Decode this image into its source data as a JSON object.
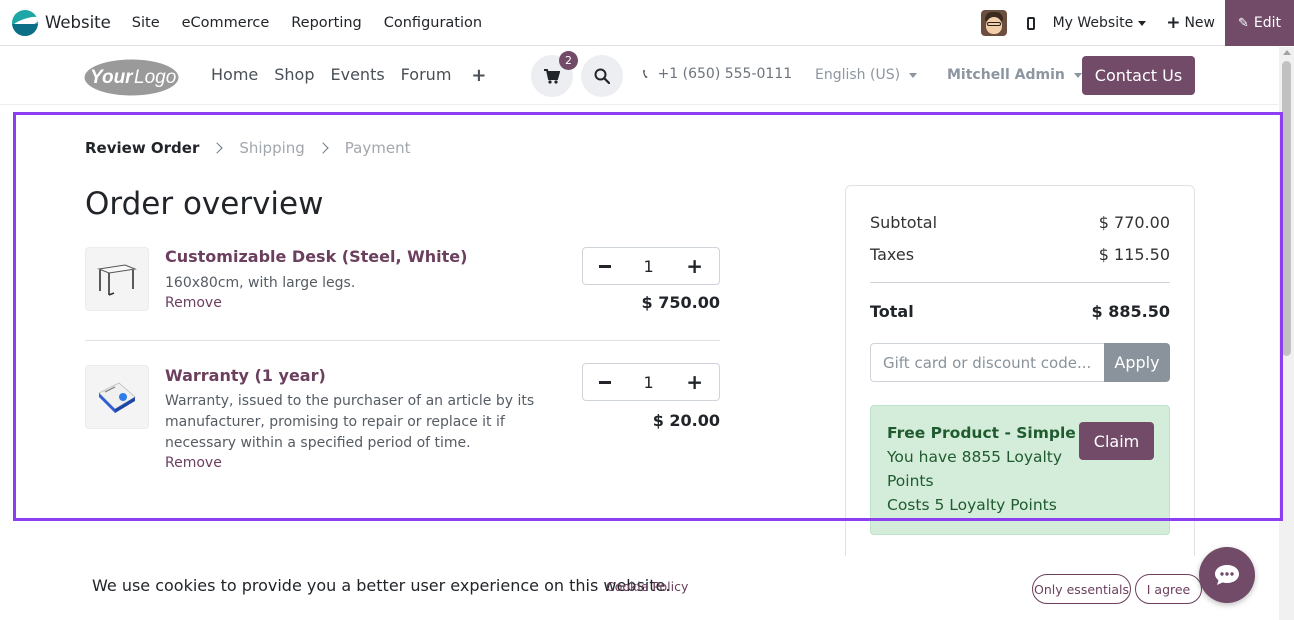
{
  "admin_bar": {
    "app_name": "Website",
    "menu": [
      "Site",
      "eCommerce",
      "Reporting",
      "Configuration"
    ],
    "website_selector": "My Website",
    "new_label": "New",
    "edit_label": "Edit"
  },
  "header": {
    "logo_text": "YourLogo",
    "nav": [
      "Home",
      "Shop",
      "Events",
      "Forum"
    ],
    "cart_count": "2",
    "phone": "+1 (650) 555-0111",
    "language": "English (US)",
    "user": "Mitchell Admin",
    "contact_label": "Contact Us"
  },
  "checkout": {
    "steps": [
      "Review Order",
      "Shipping",
      "Payment"
    ],
    "active_step": "Review Order",
    "title": "Order overview",
    "items": [
      {
        "name": "Customizable Desk (Steel, White)",
        "description": "160x80cm, with large legs.",
        "remove_label": "Remove",
        "quantity": "1",
        "price": "$ 750.00"
      },
      {
        "name": "Warranty (1 year)",
        "description": "Warranty, issued to the purchaser of an article by its manufacturer, promising to repair or replace it if necessary within a specified period of time.",
        "remove_label": "Remove",
        "quantity": "1",
        "price": "$ 20.00"
      }
    ]
  },
  "summary": {
    "subtotal_label": "Subtotal",
    "subtotal": "$ 770.00",
    "taxes_label": "Taxes",
    "taxes": "$ 115.50",
    "total_label": "Total",
    "total": "$ 885.50",
    "promo_placeholder": "Gift card or discount code...",
    "apply_label": "Apply",
    "reward": {
      "title": "Free Product - Simple Pen",
      "line1": "You have 8855 Loyalty",
      "line2": "Points",
      "line3": "Costs 5 Loyalty Points",
      "claim_label": "Claim"
    }
  },
  "cookie": {
    "text": "We use cookies to provide you a better user experience on this website.",
    "policy_link": "Cookie Policy",
    "essentials_label": "Only essentials",
    "agree_label": "I agree"
  },
  "colors": {
    "brand": "#714b67",
    "highlight": "#8b3ff0",
    "reward_bg": "#d4edda",
    "apply_bg": "#8a939b"
  },
  "icons": [
    "website-app-icon",
    "avatar",
    "mobile-icon",
    "plus-icon",
    "pencil-icon",
    "cart-icon",
    "search-icon",
    "phone-icon",
    "chevron-right-icon",
    "minus-icon",
    "chat-icon"
  ]
}
